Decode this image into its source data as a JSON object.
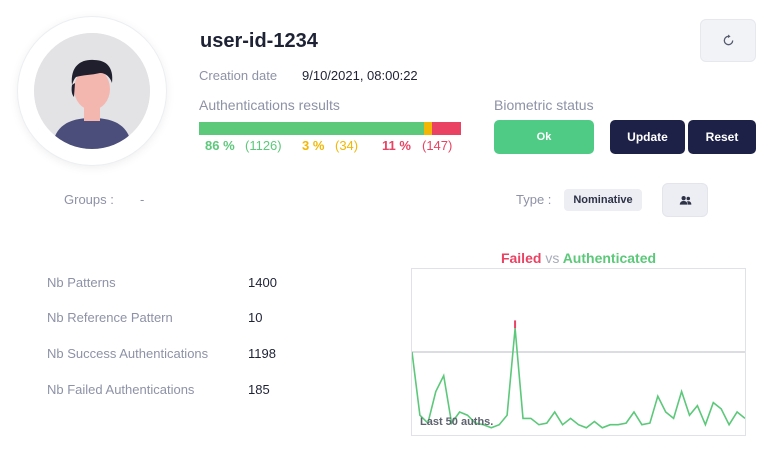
{
  "user": {
    "id": "user-id-1234"
  },
  "creation": {
    "label": "Creation date",
    "value": "9/10/2021, 08:00:22"
  },
  "auth_results": {
    "label": "Authentications results",
    "success_pct": 86,
    "warning_pct": 3,
    "failed_pct": 11,
    "success": {
      "pct": "86 %",
      "count": "(1126)"
    },
    "warning": {
      "pct": "3 %",
      "count": "(34)"
    },
    "failed": {
      "pct": "11 %",
      "count": "(147)"
    },
    "colors": {
      "success": "#5cc87a",
      "warning": "#f2b705",
      "failed": "#e94263"
    }
  },
  "biometric": {
    "label": "Biometric status",
    "status": "Ok"
  },
  "actions": {
    "update": "Update",
    "reset": "Reset",
    "refresh_icon": "refresh-icon",
    "people_icon": "people-icon"
  },
  "groups": {
    "label": "Groups :",
    "value": "-"
  },
  "type": {
    "label": "Type :",
    "value": "Nominative"
  },
  "stats": [
    {
      "label": "Nb Patterns",
      "value": "1400"
    },
    {
      "label": "Nb Reference Pattern",
      "value": "10"
    },
    {
      "label": "Nb Success Authentications",
      "value": "1198"
    },
    {
      "label": "Nb Failed Authentications",
      "value": "185"
    }
  ],
  "chart": {
    "title_failed": "Failed",
    "title_vs": "vs",
    "title_authenticated": "Authenticated",
    "note": "Last 50 auths."
  },
  "chart_data": {
    "type": "line",
    "title": "Failed vs Authenticated",
    "xlabel": "",
    "ylabel": "",
    "ylim": [
      0,
      100
    ],
    "threshold": 50,
    "series": [
      {
        "name": "Authenticated",
        "color": "#5cc87a",
        "values": [
          50,
          10,
          5,
          25,
          35,
          5,
          12,
          10,
          5,
          4,
          2,
          4,
          10,
          65,
          8,
          8,
          4,
          5,
          12,
          4,
          8,
          4,
          2,
          6,
          2,
          4,
          4,
          5,
          12,
          4,
          5,
          22,
          12,
          8,
          25,
          10,
          16,
          4,
          18,
          14,
          4,
          12,
          8
        ]
      },
      {
        "name": "Failed",
        "color": "#e94263",
        "values": [
          null,
          null,
          null,
          null,
          null,
          null,
          null,
          null,
          null,
          null,
          null,
          null,
          null,
          70,
          null,
          null,
          null,
          null,
          null,
          null,
          null,
          null,
          null,
          null,
          null,
          null,
          null,
          null,
          null,
          null,
          null,
          null,
          null,
          null,
          null,
          null,
          null,
          null,
          null,
          null,
          null,
          null,
          null
        ]
      }
    ]
  }
}
